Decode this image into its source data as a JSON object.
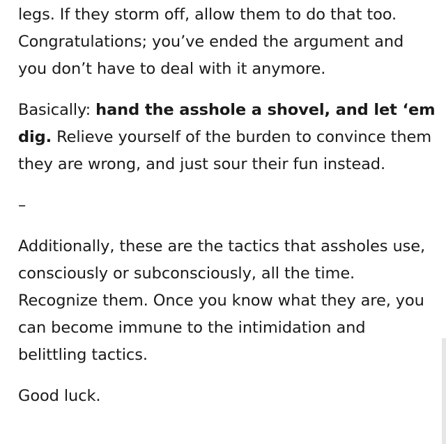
{
  "post": {
    "p1": "legs. If they storm off, allow them to do that too. Congratulations; you’ve ended the argument and you don’t have to deal with it anymore.",
    "p2_prefix": "Basically: ",
    "p2_bold": "hand the asshole a shovel, and let ‘em dig.",
    "p2_suffix": " Relieve yourself of the burden to convince them they are wrong, and just sour their fun instead.",
    "separator": "–",
    "p3": "Additionally, these are the tactics that assholes use, consciously or subconsciously, all the time. Recognize them. Once you know what they are, you can become immune to the intimidation and belittling tactics.",
    "p4": "Good luck."
  }
}
